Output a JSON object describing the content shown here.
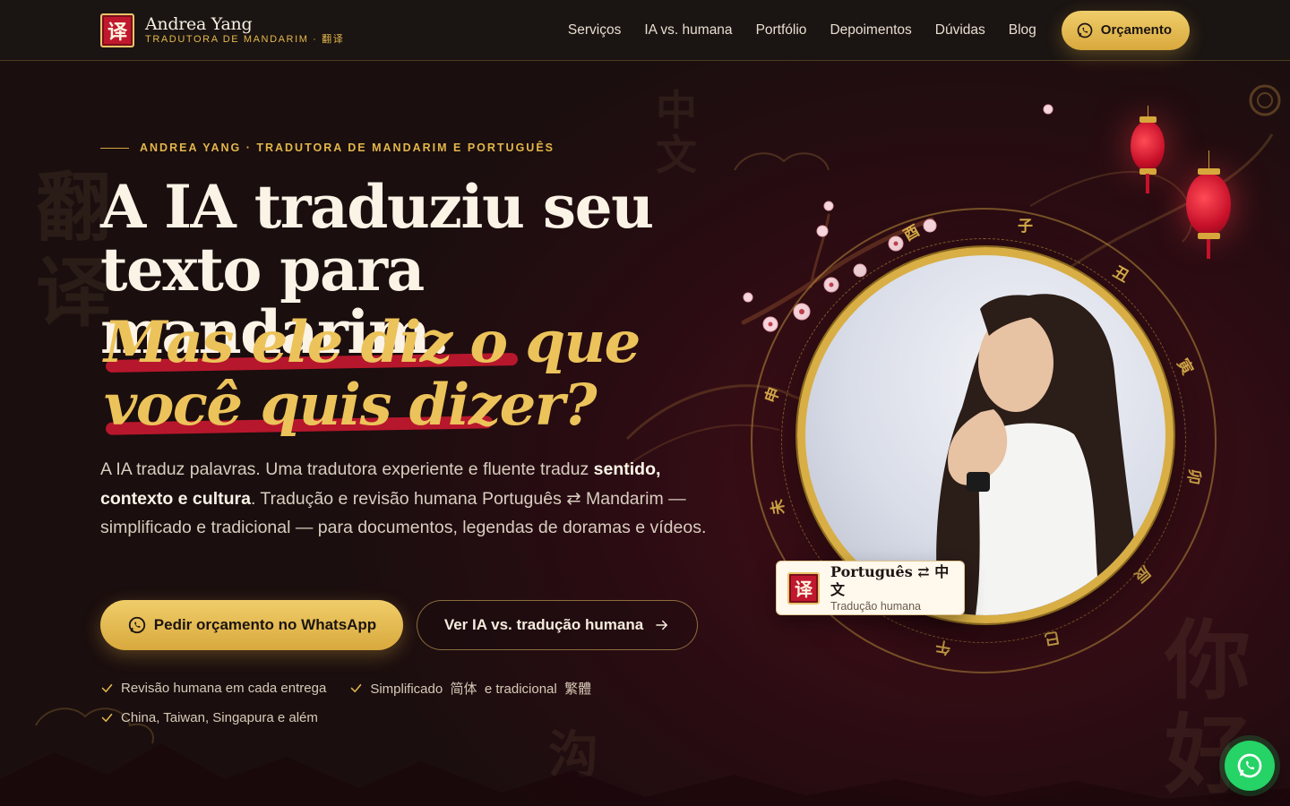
{
  "nav": {
    "brand_name": "Andrea Yang",
    "brand_sub": "TRADUTORA DE MANDARIM · 翻译",
    "logo_glyph": "译",
    "links": [
      "Serviços",
      "IA vs. humana",
      "Portfólio",
      "Depoimentos",
      "Dúvidas",
      "Blog"
    ],
    "cta_label": "Orçamento"
  },
  "hero": {
    "eyebrow": "ANDREA YANG · TRADUTORA DE MANDARIM E PORTUGUÊS",
    "headline_line1": "A IA traduziu seu",
    "headline_line2": "texto para mandarim.",
    "italic_line1": "Mas ele diz o que",
    "italic_line2": "você quis dizer?",
    "lead_part1": "A IA traduz palavras. Uma tradutora experiente e fluente traduz ",
    "lead_bold": "sentido, contexto e cultura",
    "lead_part2": ". Tradução e revisão humana Português ⇄ Mandarim — simplificado e tradicional — para documentos, legendas de doramas e vídeos.",
    "cta_primary": "Pedir orçamento no WhatsApp",
    "cta_secondary": "Ver IA vs. tradução humana",
    "checks": [
      "Revisão humana em cada entrega",
      "Simplificado  简体  e tradicional  繁體",
      "China, Taiwan, Singapura e além"
    ]
  },
  "badge": {
    "glyph": "译",
    "title": "Português ⇄ 中文",
    "subtitle": "Tradução humana"
  },
  "zodiac_glyphs": [
    "子",
    "丑",
    "寅",
    "卯",
    "辰",
    "巳",
    "午",
    "未",
    "申",
    "酉"
  ],
  "background_glyphs": [
    "中",
    "文",
    "翻",
    "译",
    "你",
    "好",
    "沟"
  ],
  "colors": {
    "accent_gold": "#e3b64a",
    "accent_red": "#c0182e",
    "whatsapp_green": "#25d366",
    "background": "#1a0e0e"
  },
  "icons": {
    "nav_cta": "whatsapp-icon",
    "cta_primary": "whatsapp-icon",
    "cta_secondary": "arrow-right-icon",
    "check": "check-icon",
    "fab": "whatsapp-icon"
  }
}
